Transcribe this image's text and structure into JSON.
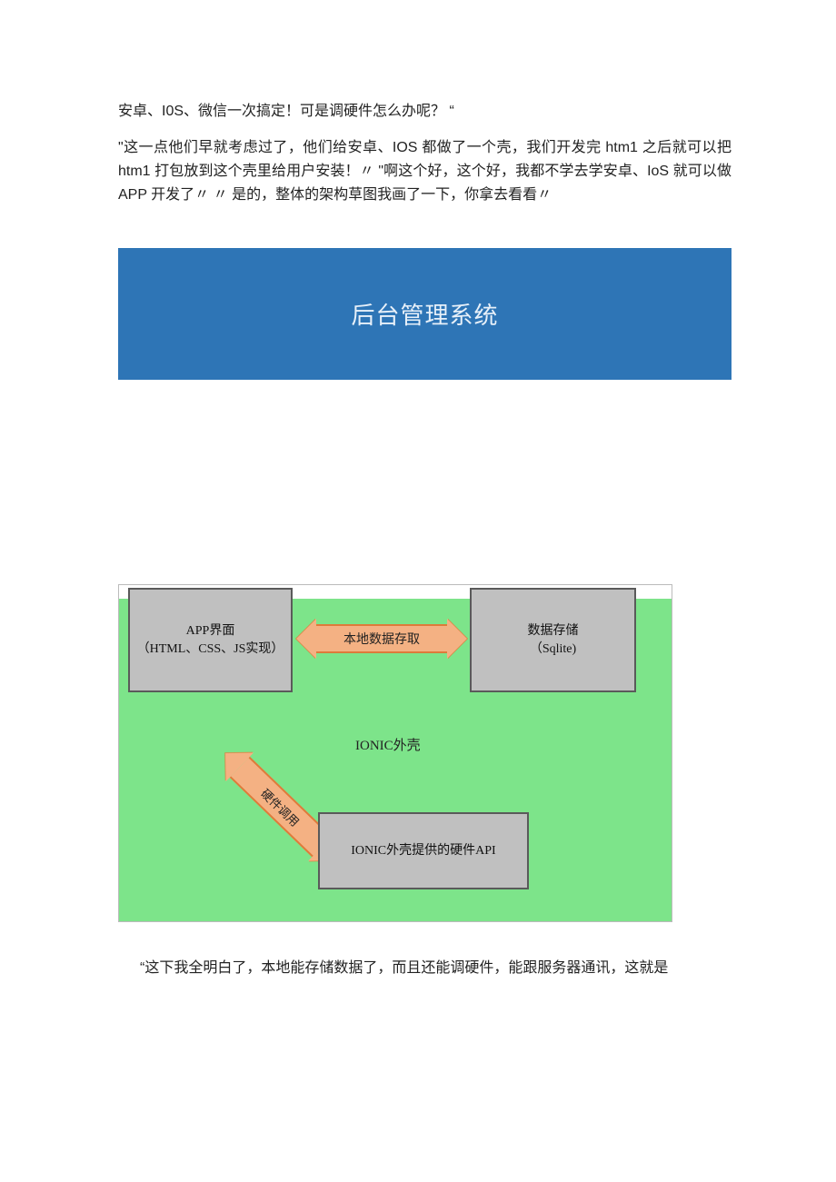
{
  "paragraph1": "安卓、I0S、微信一次搞定！可是调硬件怎么办呢？ “",
  "paragraph2": "\"这一点他们早就考虑过了，他们给安卓、IOS 都做了一个壳，我们开发完 htm1 之后就可以把 htm1 打包放到这个壳里给用户安装！〃 \"啊这个好，这个好，我都不学去学安卓、IoS 就可以做 APP 开发了〃 〃 是的，整体的架构草图我画了一下，你拿去看看〃",
  "blue_box_title": "后台管理系统",
  "diagram": {
    "app_box_line1": "APP界面",
    "app_box_line2": "（HTML、CSS、JS实现）",
    "data_box_line1": "数据存储",
    "data_box_line2": "（Sqlite)",
    "api_box": "IONIC外壳提供的硬件API",
    "ionic_label": "IONIC外壳",
    "h_arrow_label": "本地数据存取",
    "d_arrow_label": "硬件调用"
  },
  "paragraph3": "“这下我全明白了，本地能存储数据了，而且还能调硬件，能跟服务器通讯，这就是"
}
